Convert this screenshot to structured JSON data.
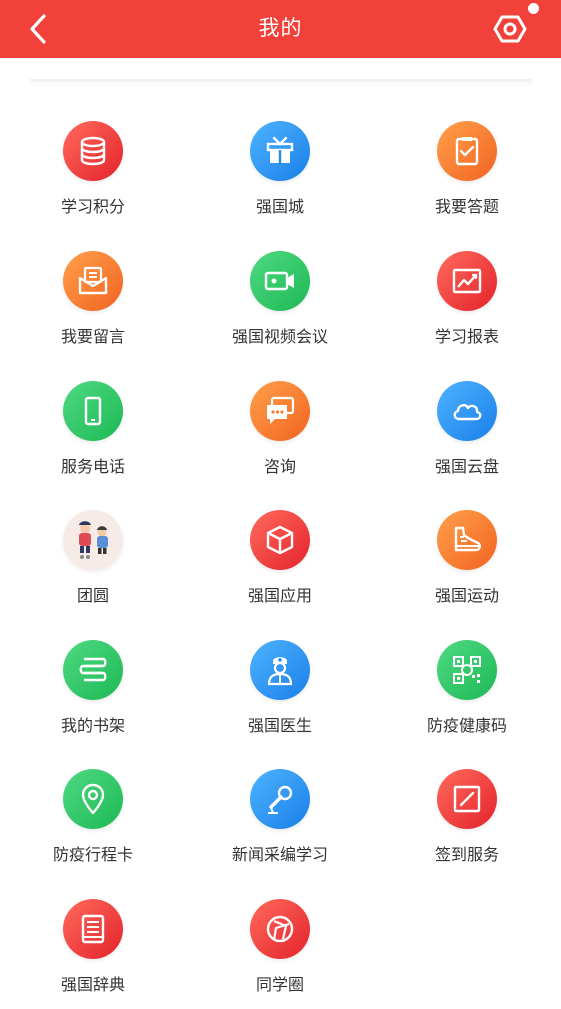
{
  "header": {
    "title": "我的",
    "back_icon": "chevron-left-icon",
    "settings_icon": "hexagon-gear-icon",
    "bg_color": "#f2403a"
  },
  "menu": [
    {
      "label": "学习积分",
      "icon": "database-icon",
      "color": "red"
    },
    {
      "label": "强国城",
      "icon": "gift-box-icon",
      "color": "blue"
    },
    {
      "label": "我要答题",
      "icon": "clipboard-check-icon",
      "color": "orange"
    },
    {
      "label": "我要留言",
      "icon": "envelope-letter-icon",
      "color": "orange"
    },
    {
      "label": "强国视频会议",
      "icon": "video-camera-icon",
      "color": "green"
    },
    {
      "label": "学习报表",
      "icon": "trend-chart-icon",
      "color": "red"
    },
    {
      "label": "服务电话",
      "icon": "mobile-phone-icon",
      "color": "green"
    },
    {
      "label": "咨询",
      "icon": "chat-bubble-icon",
      "color": "orange"
    },
    {
      "label": "强国云盘",
      "icon": "cloud-icon",
      "color": "blue"
    },
    {
      "label": "团圆",
      "icon": "reunion-illustration-icon",
      "color": "illustration"
    },
    {
      "label": "强国应用",
      "icon": "cube-icon",
      "color": "red"
    },
    {
      "label": "强国运动",
      "icon": "running-shoe-icon",
      "color": "orange"
    },
    {
      "label": "我的书架",
      "icon": "bookshelf-icon",
      "color": "green"
    },
    {
      "label": "强国医生",
      "icon": "doctor-icon",
      "color": "blue"
    },
    {
      "label": "防疫健康码",
      "icon": "qr-code-icon",
      "color": "green"
    },
    {
      "label": "防疫行程卡",
      "icon": "location-pin-icon",
      "color": "green"
    },
    {
      "label": "新闻采编学习",
      "icon": "microphone-icon",
      "color": "blue"
    },
    {
      "label": "签到服务",
      "icon": "sign-in-icon",
      "color": "red"
    },
    {
      "label": "强国辞典",
      "icon": "dictionary-book-icon",
      "color": "red"
    },
    {
      "label": "同学圈",
      "icon": "aperture-circle-icon",
      "color": "red"
    }
  ]
}
